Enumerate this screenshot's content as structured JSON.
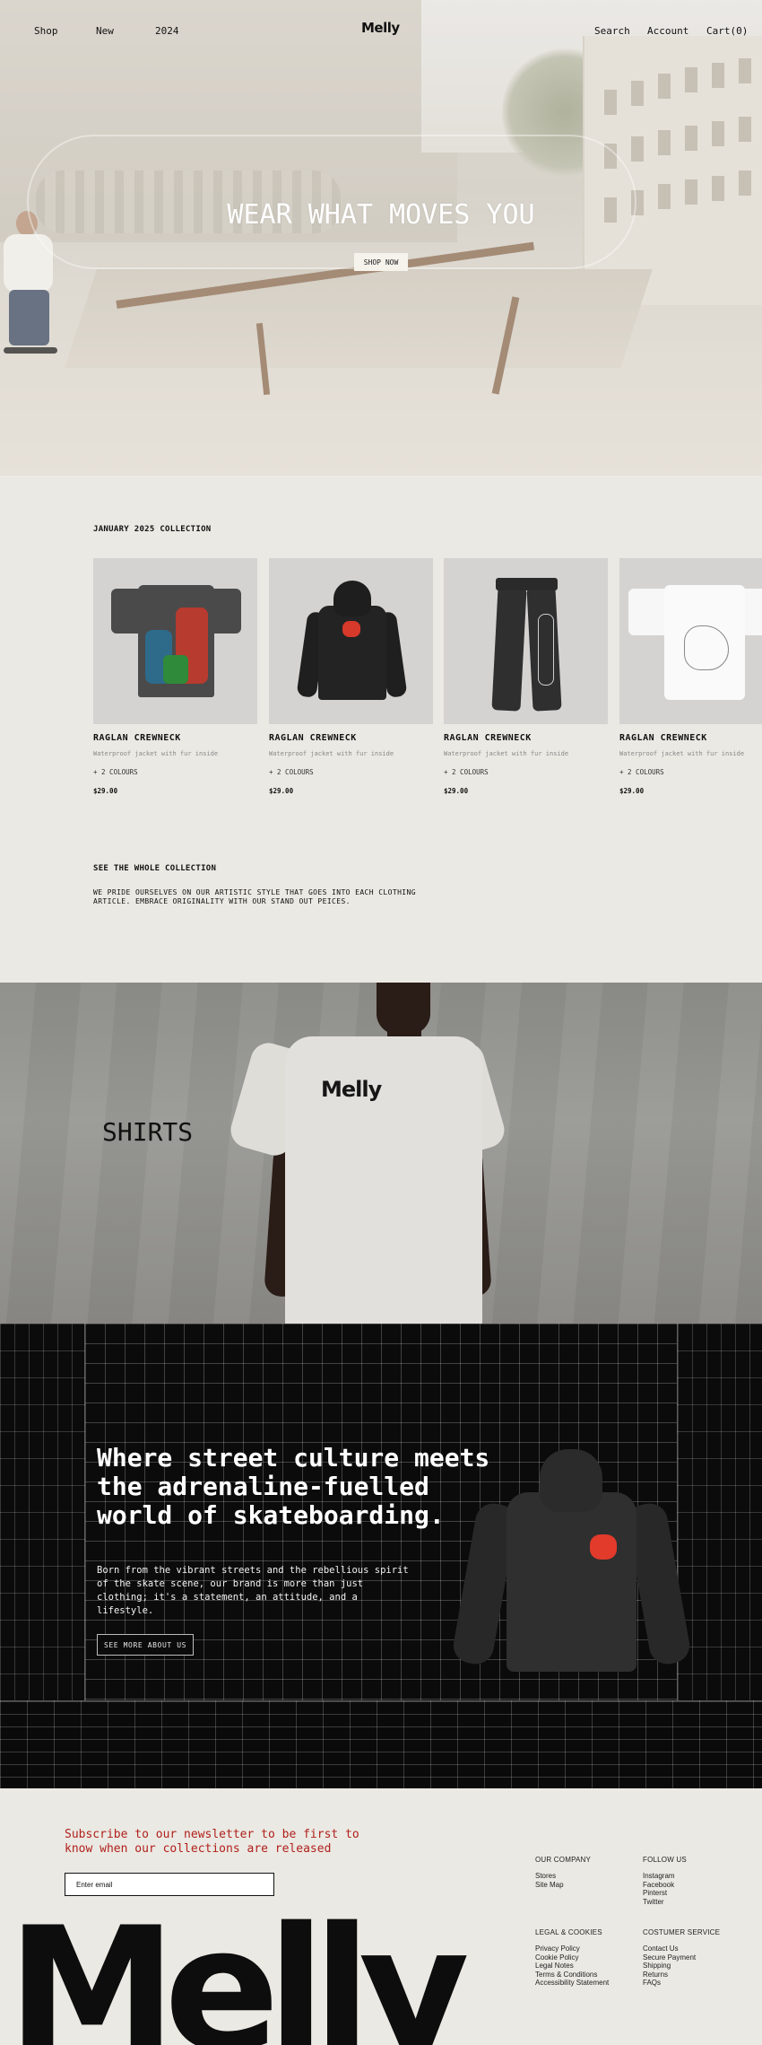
{
  "nav": {
    "left": [
      "Shop",
      "New",
      "2024"
    ],
    "logo": "Melly",
    "search": "Search",
    "account": "Account",
    "cart": "Cart(0)"
  },
  "hero": {
    "title": "WEAR WHAT MOVES YOU",
    "button": "SHOP NOW"
  },
  "collection": {
    "title": "JANUARY 2025 COLLECTION",
    "products": [
      {
        "name": "RAGLAN CREWNECK",
        "desc": "Waterproof jacket with fur inside",
        "colours": "+ 2 COLOURS",
        "price": "$29.00",
        "image": "dark-graphic-tee"
      },
      {
        "name": "RAGLAN CREWNECK",
        "desc": "Waterproof jacket with fur inside",
        "colours": "+ 2 COLOURS",
        "price": "$29.00",
        "image": "black-hoodie"
      },
      {
        "name": "RAGLAN CREWNECK",
        "desc": "Waterproof jacket with fur inside",
        "colours": "+ 2 COLOURS",
        "price": "$29.00",
        "image": "black-sweatpants"
      },
      {
        "name": "RAGLAN CREWNECK",
        "desc": "Waterproof jacket with fur inside",
        "colours": "+ 2 COLOURS",
        "price": "$29.00",
        "image": "white-tee"
      }
    ],
    "see_title": "SEE THE WHOLE COLLECTION",
    "see_text": "WE PRIDE OURSELVES ON OUR ARTISTIC STYLE THAT GOES INTO EACH CLOTHING ARTICLE. EMBRACE ORIGINALITY WITH OUR STAND OUT PEICES."
  },
  "shirts": {
    "label": "SHIRTS",
    "print": "Melly"
  },
  "street": {
    "headline": "Where street culture meets the adrenaline-fuelled world of skateboarding.",
    "body": "Born from the vibrant streets and the rebellious spirit of the skate scene, our brand is more than just clothing; it's a statement, an attitude, and a lifestyle.",
    "button": "SEE MORE ABOUT US"
  },
  "footer": {
    "newsletter": "Subscribe to our newsletter to be first to know when our collections are released",
    "email_placeholder": "Enter email",
    "columns": [
      {
        "head": "OUR COMPANY",
        "links": [
          "Stores",
          "Site Map"
        ]
      },
      {
        "head": "FOLLOW US",
        "links": [
          "Instagram",
          "Facebook",
          "Pinterst",
          "Twitter"
        ]
      },
      {
        "head": "LEGAL & COOKIES",
        "links": [
          "Privacy Policy",
          "Cookie Policy",
          "Legal Notes",
          "Terms & Conditions",
          "Accessibility Statement"
        ]
      },
      {
        "head": "COSTUMER SERVICE",
        "links": [
          "Contact Us",
          "Secure Payment",
          "Shipping",
          "Returns",
          "FAQs"
        ]
      }
    ],
    "big_logo": "Melly"
  },
  "colors": {
    "background": "#ebe9e3",
    "accent_red": "#b0201c",
    "dark": "#0b0b0b"
  }
}
